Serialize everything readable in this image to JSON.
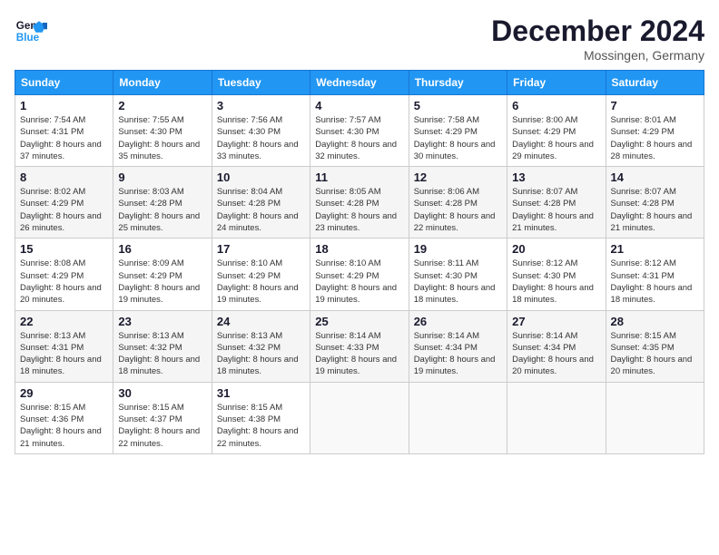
{
  "header": {
    "logo_line1": "General",
    "logo_line2": "Blue",
    "month_year": "December 2024",
    "location": "Mossingen, Germany"
  },
  "days_of_week": [
    "Sunday",
    "Monday",
    "Tuesday",
    "Wednesday",
    "Thursday",
    "Friday",
    "Saturday"
  ],
  "weeks": [
    [
      {
        "day": "1",
        "info": "Sunrise: 7:54 AM\nSunset: 4:31 PM\nDaylight: 8 hours and 37 minutes."
      },
      {
        "day": "2",
        "info": "Sunrise: 7:55 AM\nSunset: 4:30 PM\nDaylight: 8 hours and 35 minutes."
      },
      {
        "day": "3",
        "info": "Sunrise: 7:56 AM\nSunset: 4:30 PM\nDaylight: 8 hours and 33 minutes."
      },
      {
        "day": "4",
        "info": "Sunrise: 7:57 AM\nSunset: 4:30 PM\nDaylight: 8 hours and 32 minutes."
      },
      {
        "day": "5",
        "info": "Sunrise: 7:58 AM\nSunset: 4:29 PM\nDaylight: 8 hours and 30 minutes."
      },
      {
        "day": "6",
        "info": "Sunrise: 8:00 AM\nSunset: 4:29 PM\nDaylight: 8 hours and 29 minutes."
      },
      {
        "day": "7",
        "info": "Sunrise: 8:01 AM\nSunset: 4:29 PM\nDaylight: 8 hours and 28 minutes."
      }
    ],
    [
      {
        "day": "8",
        "info": "Sunrise: 8:02 AM\nSunset: 4:29 PM\nDaylight: 8 hours and 26 minutes."
      },
      {
        "day": "9",
        "info": "Sunrise: 8:03 AM\nSunset: 4:28 PM\nDaylight: 8 hours and 25 minutes."
      },
      {
        "day": "10",
        "info": "Sunrise: 8:04 AM\nSunset: 4:28 PM\nDaylight: 8 hours and 24 minutes."
      },
      {
        "day": "11",
        "info": "Sunrise: 8:05 AM\nSunset: 4:28 PM\nDaylight: 8 hours and 23 minutes."
      },
      {
        "day": "12",
        "info": "Sunrise: 8:06 AM\nSunset: 4:28 PM\nDaylight: 8 hours and 22 minutes."
      },
      {
        "day": "13",
        "info": "Sunrise: 8:07 AM\nSunset: 4:28 PM\nDaylight: 8 hours and 21 minutes."
      },
      {
        "day": "14",
        "info": "Sunrise: 8:07 AM\nSunset: 4:28 PM\nDaylight: 8 hours and 21 minutes."
      }
    ],
    [
      {
        "day": "15",
        "info": "Sunrise: 8:08 AM\nSunset: 4:29 PM\nDaylight: 8 hours and 20 minutes."
      },
      {
        "day": "16",
        "info": "Sunrise: 8:09 AM\nSunset: 4:29 PM\nDaylight: 8 hours and 19 minutes."
      },
      {
        "day": "17",
        "info": "Sunrise: 8:10 AM\nSunset: 4:29 PM\nDaylight: 8 hours and 19 minutes."
      },
      {
        "day": "18",
        "info": "Sunrise: 8:10 AM\nSunset: 4:29 PM\nDaylight: 8 hours and 19 minutes."
      },
      {
        "day": "19",
        "info": "Sunrise: 8:11 AM\nSunset: 4:30 PM\nDaylight: 8 hours and 18 minutes."
      },
      {
        "day": "20",
        "info": "Sunrise: 8:12 AM\nSunset: 4:30 PM\nDaylight: 8 hours and 18 minutes."
      },
      {
        "day": "21",
        "info": "Sunrise: 8:12 AM\nSunset: 4:31 PM\nDaylight: 8 hours and 18 minutes."
      }
    ],
    [
      {
        "day": "22",
        "info": "Sunrise: 8:13 AM\nSunset: 4:31 PM\nDaylight: 8 hours and 18 minutes."
      },
      {
        "day": "23",
        "info": "Sunrise: 8:13 AM\nSunset: 4:32 PM\nDaylight: 8 hours and 18 minutes."
      },
      {
        "day": "24",
        "info": "Sunrise: 8:13 AM\nSunset: 4:32 PM\nDaylight: 8 hours and 18 minutes."
      },
      {
        "day": "25",
        "info": "Sunrise: 8:14 AM\nSunset: 4:33 PM\nDaylight: 8 hours and 19 minutes."
      },
      {
        "day": "26",
        "info": "Sunrise: 8:14 AM\nSunset: 4:34 PM\nDaylight: 8 hours and 19 minutes."
      },
      {
        "day": "27",
        "info": "Sunrise: 8:14 AM\nSunset: 4:34 PM\nDaylight: 8 hours and 20 minutes."
      },
      {
        "day": "28",
        "info": "Sunrise: 8:15 AM\nSunset: 4:35 PM\nDaylight: 8 hours and 20 minutes."
      }
    ],
    [
      {
        "day": "29",
        "info": "Sunrise: 8:15 AM\nSunset: 4:36 PM\nDaylight: 8 hours and 21 minutes."
      },
      {
        "day": "30",
        "info": "Sunrise: 8:15 AM\nSunset: 4:37 PM\nDaylight: 8 hours and 22 minutes."
      },
      {
        "day": "31",
        "info": "Sunrise: 8:15 AM\nSunset: 4:38 PM\nDaylight: 8 hours and 22 minutes."
      },
      null,
      null,
      null,
      null
    ]
  ]
}
